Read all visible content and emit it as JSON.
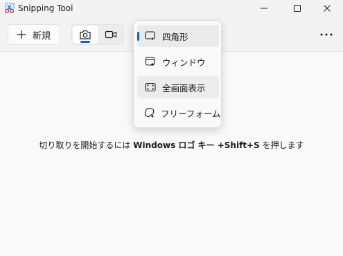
{
  "window": {
    "title": "Snipping Tool"
  },
  "toolbar": {
    "new_label": "新規",
    "modes": [
      {
        "name": "photo",
        "icon": "camera-icon",
        "active": true
      },
      {
        "name": "video",
        "icon": "video-camera-icon",
        "active": false
      }
    ]
  },
  "menu": {
    "items": [
      {
        "label": "四角形",
        "icon": "rectangle-snip-icon",
        "selected": true
      },
      {
        "label": "ウィンドウ",
        "icon": "window-snip-icon",
        "selected": false
      },
      {
        "label": "全画面表示",
        "icon": "fullscreen-snip-icon",
        "selected": false
      },
      {
        "label": "フリーフォーム",
        "icon": "freeform-snip-icon",
        "selected": false
      }
    ]
  },
  "hint": {
    "prefix": "切り取りを開始するには ",
    "keys": "Windows ロゴ キー +Shift+S",
    "suffix": " を押します"
  },
  "colors": {
    "accent": "#0067c0",
    "background": "#f3f3f3"
  }
}
